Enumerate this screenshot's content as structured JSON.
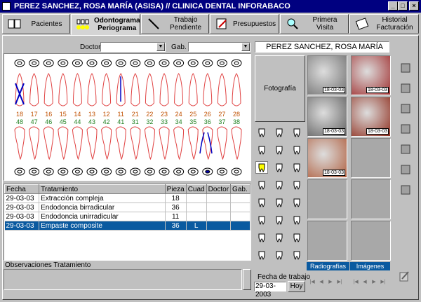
{
  "window": {
    "title": "PEREZ SANCHEZ, ROSA MARÍA (ASISA) // CLINICA DENTAL INFORABACO"
  },
  "tabs": [
    {
      "label": "Pacientes",
      "icon": "book-icon"
    },
    {
      "label": "Odontograma Periograma",
      "icon": "teeth-icon",
      "active": true
    },
    {
      "label": "Trabajo Pendiente",
      "icon": "dental-tool-icon"
    },
    {
      "label": "Presupuestos",
      "icon": "document-pen-icon"
    },
    {
      "label": "Primera Visita",
      "icon": "magnifier-icon"
    },
    {
      "label": "Historial Facturación",
      "icon": "ledger-icon"
    }
  ],
  "filters": {
    "doctor_label": "Doctor",
    "gab_label": "Gab.",
    "patient_name": "PEREZ SANCHEZ, ROSA MARÍA"
  },
  "teeth": {
    "upper": [
      "18",
      "17",
      "16",
      "15",
      "14",
      "13",
      "12",
      "11",
      "21",
      "22",
      "23",
      "24",
      "25",
      "26",
      "27",
      "28"
    ],
    "lower": [
      "48",
      "47",
      "46",
      "45",
      "44",
      "43",
      "42",
      "41",
      "31",
      "32",
      "33",
      "34",
      "35",
      "36",
      "37",
      "38"
    ]
  },
  "treatments": {
    "columns": [
      "Fecha",
      "Tratamiento",
      "Pieza",
      "Cuad",
      "Doctor",
      "Gab."
    ],
    "rows": [
      {
        "fecha": "29-03-03",
        "tratamiento": "Extracción compleja",
        "pieza": "18",
        "cuad": "",
        "doctor": "",
        "gab": ""
      },
      {
        "fecha": "29-03-03",
        "tratamiento": "Endodoncia birradicular",
        "pieza": "36",
        "cuad": "",
        "doctor": "",
        "gab": ""
      },
      {
        "fecha": "29-03-03",
        "tratamiento": "Endodoncia unirradicular",
        "pieza": "11",
        "cuad": "",
        "doctor": "",
        "gab": ""
      },
      {
        "fecha": "29-03-03",
        "tratamiento": "Empaste composite",
        "pieza": "36",
        "cuad": "L",
        "doctor": "",
        "gab": "",
        "selected": true
      }
    ]
  },
  "observaciones_label": "Observaciones Tratamiento",
  "fotografia_label": "Fotografía",
  "work_date": {
    "label": "Fecha de trabajo",
    "value": "29-03-2003",
    "hoy_label": "Hoy"
  },
  "images": {
    "dates": [
      "18-03-03",
      "18-03-03",
      "18-03-03",
      "18-03-03",
      "18-03-03"
    ],
    "radiografias_label": "Radiografías",
    "imagenes_label": "Imágenes"
  },
  "colors": {
    "accent": "#0a5aa0",
    "upper_num": "#c05000",
    "lower_num": "#208020",
    "tooth": "#e04040"
  }
}
